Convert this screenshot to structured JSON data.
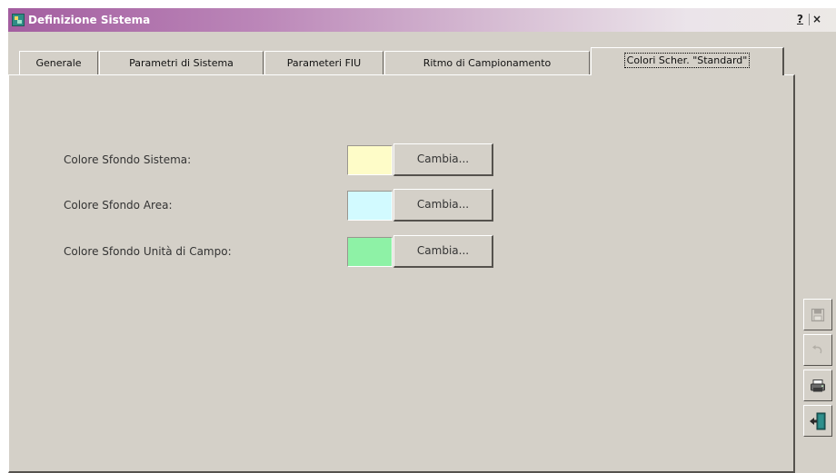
{
  "window": {
    "title": "Definizione Sistema",
    "help_label": "?",
    "close_label": "×"
  },
  "tabs": [
    {
      "label": "Generale",
      "active": false
    },
    {
      "label": "Parametri di Sistema",
      "active": false
    },
    {
      "label": "Parameteri FIU",
      "active": false
    },
    {
      "label": "Ritmo di Campionamento",
      "active": false
    },
    {
      "label": "Colori Scher. \"Standard\"",
      "active": true
    }
  ],
  "rows": [
    {
      "label": "Colore Sfondo Sistema:",
      "color": "#fefcc8",
      "button": "Cambia..."
    },
    {
      "label": "Colore Sfondo Area:",
      "color": "#d2faff",
      "button": "Cambia..."
    },
    {
      "label": "Colore Sfondo Unità di Campo:",
      "color": "#8ef2a6",
      "button": "Cambia..."
    }
  ],
  "side_toolbar": [
    {
      "icon": "save-icon",
      "enabled": false
    },
    {
      "icon": "undo-icon",
      "enabled": false
    },
    {
      "icon": "print-icon",
      "enabled": true
    },
    {
      "icon": "exit-door-icon",
      "enabled": true
    }
  ]
}
